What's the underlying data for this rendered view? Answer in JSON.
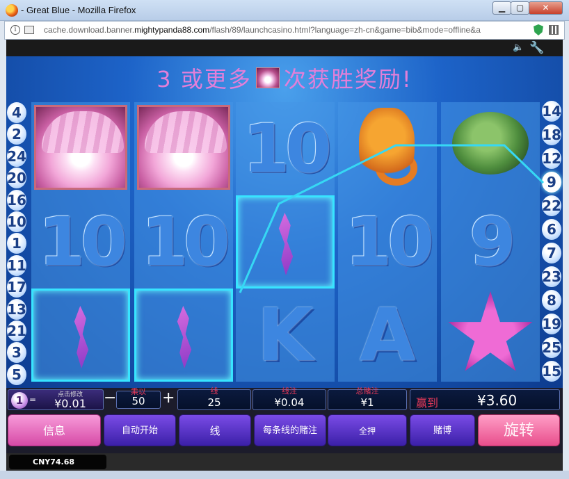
{
  "window": {
    "title": "- Great Blue - Mozilla Firefox",
    "min_label": "▁",
    "max_label": "▢",
    "close_label": "✕"
  },
  "address": {
    "url_prefix": "cache.download.banner.",
    "url_domain": "mightypanda88.com",
    "url_path": "/flash/89/launchcasino.html?language=zh-cn&game=bib&mode=offline&a"
  },
  "icons": {
    "speaker": "🔈",
    "wrench": "🔧"
  },
  "game": {
    "banner_prefix": "3 或更多",
    "banner_suffix": "次获胜奖励!",
    "paylines_left": [
      "4",
      "2",
      "24",
      "20",
      "16",
      "10",
      "1",
      "11",
      "17",
      "13",
      "21",
      "3",
      "5"
    ],
    "paylines_right": [
      "14",
      "18",
      "12",
      "9",
      "22",
      "6",
      "7",
      "23",
      "8",
      "19",
      "25",
      "15"
    ],
    "active_payline": "9",
    "reels": [
      [
        "clam",
        "10",
        "wild"
      ],
      [
        "clam",
        "10",
        "wild"
      ],
      [
        "10",
        "wild",
        "K"
      ],
      [
        "seahorse",
        "10",
        "A"
      ],
      [
        "turtle",
        "9",
        "starfish"
      ]
    ]
  },
  "controls": {
    "coin_value_label": "点击修改",
    "coin_value": "¥0.01",
    "coin_symbol": "1",
    "coin_eq": "=",
    "multiplier_label": "乘以",
    "multiplier_value": "50",
    "minus": "−",
    "plus": "+",
    "lines_label": "线",
    "lines_value": "25",
    "line_bet_label": "线注",
    "line_bet_value": "¥0.04",
    "total_bet_label": "总赌注",
    "total_bet_value": "¥1",
    "win_label": "赢到",
    "win_value": "¥3.60",
    "buttons": {
      "info": "信息",
      "autoplay": "自动开始",
      "lines": "线",
      "bet_per_line": "每条线的赌注",
      "max_bet": "全押",
      "gamble": "赌博",
      "spin": "旋转"
    }
  },
  "status": {
    "balance": "CNY74.68"
  },
  "colors": {
    "banner_text": "#e27fd9",
    "highlight": "#38e4ff",
    "label_red": "#e83a5a"
  }
}
